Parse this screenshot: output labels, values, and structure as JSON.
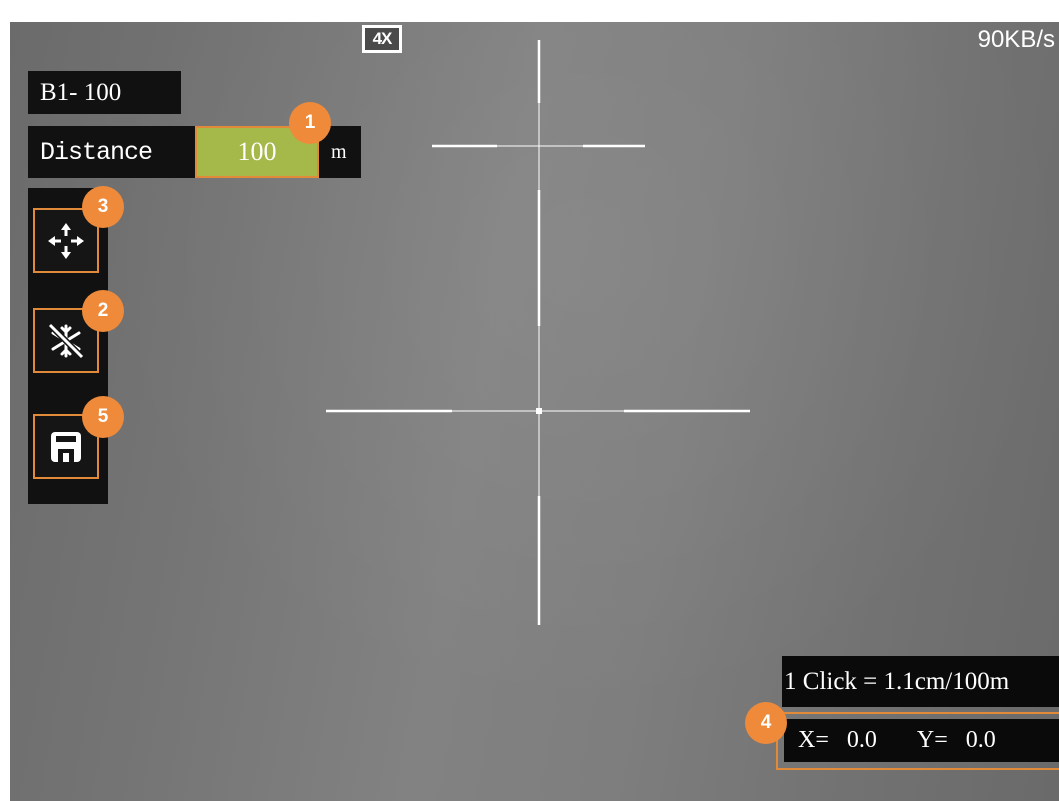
{
  "view": {
    "zoom_label": "4X",
    "data_rate": "90KB/s"
  },
  "profile": {
    "label": "B1- 100"
  },
  "distance": {
    "label": "Distance",
    "value": "100",
    "unit": "m"
  },
  "toolbar": {
    "buttons": [
      {
        "name": "move",
        "icon": "move-arrows-icon"
      },
      {
        "name": "freeze",
        "icon": "snowflake-slash-icon"
      },
      {
        "name": "save",
        "icon": "floppy-disk-icon"
      }
    ]
  },
  "callouts": [
    "1",
    "2",
    "3",
    "4",
    "5"
  ],
  "click_value": {
    "label": "1 Click = 1.1cm/100m"
  },
  "offset": {
    "x_label": "X=",
    "x_value": "0.0",
    "y_label": "Y=",
    "y_value": "0.0"
  },
  "colors": {
    "accent": "#ee8a3a",
    "field_green": "#a5b94a",
    "panel": "#111111"
  }
}
